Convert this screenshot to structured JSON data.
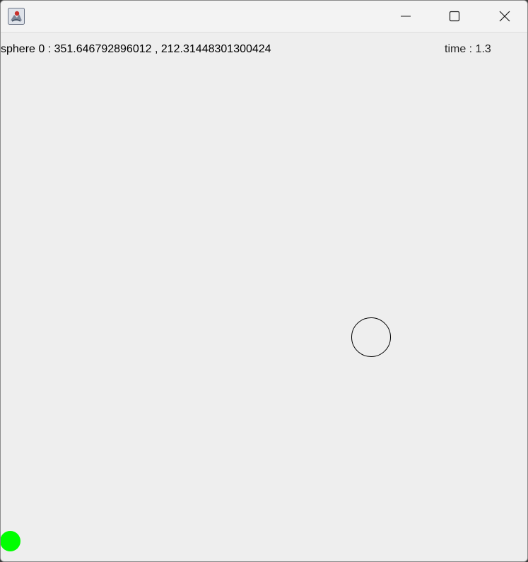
{
  "window": {
    "title": "",
    "controls": {
      "minimize_icon": "minimize-icon",
      "maximize_icon": "maximize-icon",
      "close_icon": "close-icon"
    }
  },
  "canvas": {
    "sphere_label": "sphere 0 : 351.646792896012 , 212.31448301300424",
    "time_label": "time : 1.3"
  },
  "colors": {
    "background": "#eeeeee",
    "titlebar": "#f3f3f3",
    "sphere_outline": "#000000",
    "green_dot": "#00ff00"
  }
}
